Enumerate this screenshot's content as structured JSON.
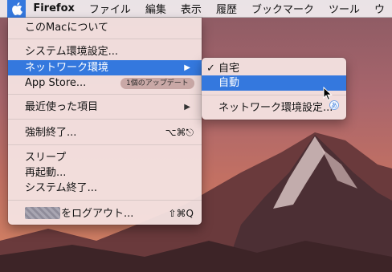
{
  "menubar": {
    "app_name": "Firefox",
    "items": [
      "ファイル",
      "編集",
      "表示",
      "履歴",
      "ブックマーク",
      "ツール",
      "ウ"
    ]
  },
  "apple_menu": {
    "about": "このMacについて",
    "system_prefs": "システム環境設定...",
    "network": "ネットワーク環境",
    "app_store": "App Store...",
    "app_store_badge": "1個のアップデート",
    "recent_items": "最近使った項目",
    "force_quit": "強制終了...",
    "force_quit_shortcut": "⌥⌘⎋",
    "sleep": "スリープ",
    "restart": "再起動...",
    "shutdown": "システム終了...",
    "logout": "をログアウト...",
    "logout_shortcut": "⇧⌘Q"
  },
  "network_submenu": {
    "items": [
      "自宅",
      "自動"
    ],
    "checked_index": 0,
    "selected_index": 1,
    "settings": "ネットワーク環境設定...",
    "ime_label": "あ"
  },
  "colors": {
    "highlight": "#3478de",
    "menu_bg": "#f4e3e2"
  }
}
